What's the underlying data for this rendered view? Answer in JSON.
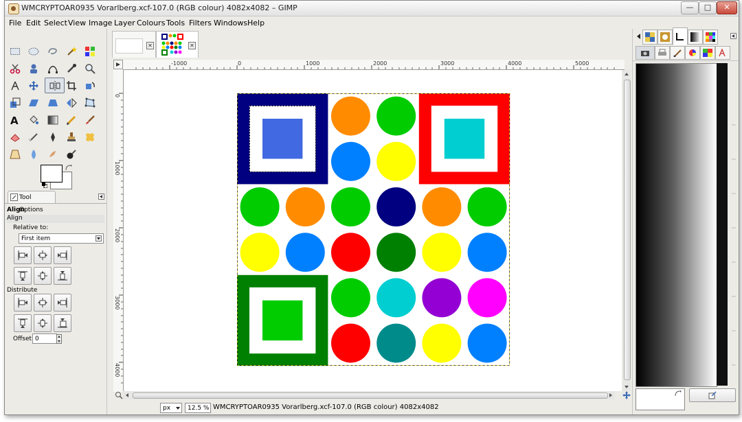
{
  "window": {
    "title": "WMCRYPTOAR0935 Vorarlberg.xcf-107.0 (RGB colour) 4082x4082 – GIMP",
    "controls": {
      "minimize": "—",
      "maximize": "□",
      "close": "✕"
    }
  },
  "menubar": {
    "items": [
      "File",
      "Edit",
      "Select",
      "View",
      "Image",
      "Layer",
      "Colours",
      "Tools",
      "Filters",
      "Windows",
      "Help"
    ]
  },
  "toolbox": {
    "tools": [
      "rect-select",
      "ellipse-select",
      "free-select",
      "fuzzy-select",
      "select-by-color",
      "scissors",
      "foreground-select",
      "paths",
      "color-picker",
      "zoom",
      "measure",
      "move",
      "align",
      "crop",
      "rotate",
      "scale",
      "shear",
      "perspective",
      "flip",
      "cage",
      "text",
      "bucket-fill",
      "blend",
      "pencil",
      "paintbrush",
      "eraser",
      "airbrush",
      "ink",
      "clone",
      "heal",
      "perspective-clone",
      "blur",
      "smudge",
      "dodge-burn"
    ],
    "colors": {
      "foreground": "#ffffff",
      "background": "#ffffff"
    }
  },
  "tool_options": {
    "tab_label": "Tool Options",
    "tool_name": "Align",
    "subtitle": "Align",
    "relative_to_label": "Relative to:",
    "relative_to_value": "First item",
    "distribute_label": "Distribute",
    "offset_label": "Offset:",
    "offset_value": "0"
  },
  "image_window": {
    "ruler_h": [
      "-1000",
      "0",
      "1000",
      "2000",
      "3000",
      "4000",
      "5000"
    ],
    "ruler_v": [
      "0",
      "1000",
      "2000",
      "3000",
      "4000"
    ],
    "unit": "px",
    "zoom": "12.5 %",
    "status": "WMCRYPTOAR0935 Vorarlberg.xcf-107.0 (RGB colour) 4082x4082"
  },
  "canvas": {
    "squares": [
      {
        "outer": "#000080",
        "inner": "#4169e1"
      },
      {
        "outer": "#ff0000",
        "inner": "#00ced1"
      },
      {
        "outer": "#008000",
        "inner": "#00cc00"
      }
    ],
    "circles": [
      {
        "color": "#ff8c00"
      },
      {
        "color": "#00cc00"
      },
      {
        "color": "#0080ff"
      },
      {
        "color": "#ffff00"
      },
      {
        "color": "#00cc00"
      },
      {
        "color": "#ff8c00"
      },
      {
        "color": "#00cc00"
      },
      {
        "color": "#000080"
      },
      {
        "color": "#ff8c00"
      },
      {
        "color": "#00cc00"
      },
      {
        "color": "#ffff00"
      },
      {
        "color": "#0080ff"
      },
      {
        "color": "#ff0000"
      },
      {
        "color": "#008000"
      },
      {
        "color": "#ffff00"
      },
      {
        "color": "#0080ff"
      },
      {
        "color": "#00cc00"
      },
      {
        "color": "#00ced1"
      },
      {
        "color": "#9400d3"
      },
      {
        "color": "#ff00ff"
      },
      {
        "color": "#ff0000"
      },
      {
        "color": "#008b8b"
      },
      {
        "color": "#ffff00"
      },
      {
        "color": "#0080ff"
      }
    ]
  }
}
